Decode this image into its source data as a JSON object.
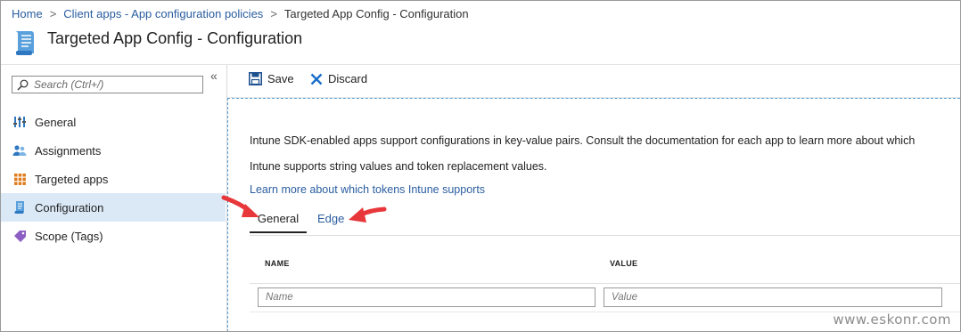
{
  "breadcrumb": {
    "items": [
      "Home",
      "Client apps - App configuration policies"
    ],
    "current": "Targeted App Config - Configuration",
    "separator": ">"
  },
  "header": {
    "title": "Targeted App Config - Configuration",
    "icon": "document-scroll-icon"
  },
  "sidebar": {
    "search_placeholder": "Search (Ctrl+/)",
    "collapse_glyph": "«",
    "items": [
      {
        "label": "General",
        "icon": "bars-icon",
        "active": false
      },
      {
        "label": "Assignments",
        "icon": "users-icon",
        "active": false
      },
      {
        "label": "Targeted apps",
        "icon": "grid-icon",
        "active": false
      },
      {
        "label": "Configuration",
        "icon": "document-icon",
        "active": true
      },
      {
        "label": "Scope (Tags)",
        "icon": "tag-icon",
        "active": false
      }
    ]
  },
  "toolbar": {
    "save_label": "Save",
    "discard_label": "Discard"
  },
  "content": {
    "para1": "Intune SDK-enabled apps support configurations in key-value pairs. Consult the documentation for each app to learn more about which",
    "para2": "Intune supports string values and token replacement values.",
    "link": "Learn more about which tokens Intune supports",
    "tabs": [
      {
        "label": "General",
        "selected": true
      },
      {
        "label": "Edge",
        "selected": false
      }
    ],
    "columns": [
      "NAME",
      "VALUE"
    ],
    "name_placeholder": "Name",
    "value_placeholder": "Value"
  },
  "watermark": "www.eskonr.com",
  "colors": {
    "link": "#2a5d9f",
    "active_nav": "#dbe9f7",
    "save_icon": "#1e4f8f",
    "discard_icon": "#1a6fc9",
    "annotation_arrow": "#e8373a",
    "dashed_border": "#5ea0d8"
  }
}
